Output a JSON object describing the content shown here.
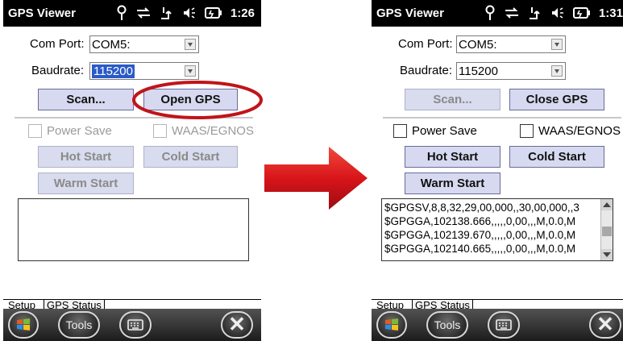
{
  "colors": {
    "titlebar": "#000000",
    "button_face": "#d7d9f0",
    "selection": "#2a5ac8",
    "highlight_ring": "#c0141a",
    "flow_arrow": "#d8151b"
  },
  "icons": [
    "windows-logo-icon",
    "keyboard-icon",
    "close-icon",
    "signal-icon",
    "sync-icon",
    "network-icon",
    "speaker-icon",
    "battery-icon",
    "dropdown-arrow-icon",
    "flow-arrow-icon"
  ],
  "before": {
    "title": "GPS Viewer",
    "time": "1:26",
    "com_port_label": "Com Port:",
    "com_port_value": "COM5:",
    "baudrate_label": "Baudrate:",
    "baudrate_value": "115200",
    "scan_label": "Scan...",
    "gps_toggle_label": "Open GPS",
    "power_save_label": "Power Save",
    "waas_label": "WAAS/EGNOS",
    "hot_start_label": "Hot Start",
    "cold_start_label": "Cold Start",
    "warm_start_label": "Warm Start",
    "log_lines": [],
    "tabs": [
      "Setup",
      "GPS Status"
    ],
    "softkey_tools": "Tools",
    "softkey_close": "✕"
  },
  "after": {
    "title": "GPS Viewer",
    "time": "1:31",
    "com_port_label": "Com Port:",
    "com_port_value": "COM5:",
    "baudrate_label": "Baudrate:",
    "baudrate_value": "115200",
    "scan_label": "Scan...",
    "gps_toggle_label": "Close GPS",
    "power_save_label": "Power Save",
    "waas_label": "WAAS/EGNOS",
    "hot_start_label": "Hot Start",
    "cold_start_label": "Cold Start",
    "warm_start_label": "Warm Start",
    "log_lines": [
      "$GPGSV,8,8,32,29,00,000,,30,00,000,,3",
      "$GPGGA,102138.666,,,,,0,00,,,M,0.0,M",
      "$GPGGA,102139.670,,,,,0,00,,,M,0.0,M",
      "$GPGGA,102140.665,,,,,0,00,,,M,0.0,M"
    ],
    "tabs": [
      "Setup",
      "GPS Status"
    ],
    "softkey_tools": "Tools",
    "softkey_close": "✕"
  }
}
